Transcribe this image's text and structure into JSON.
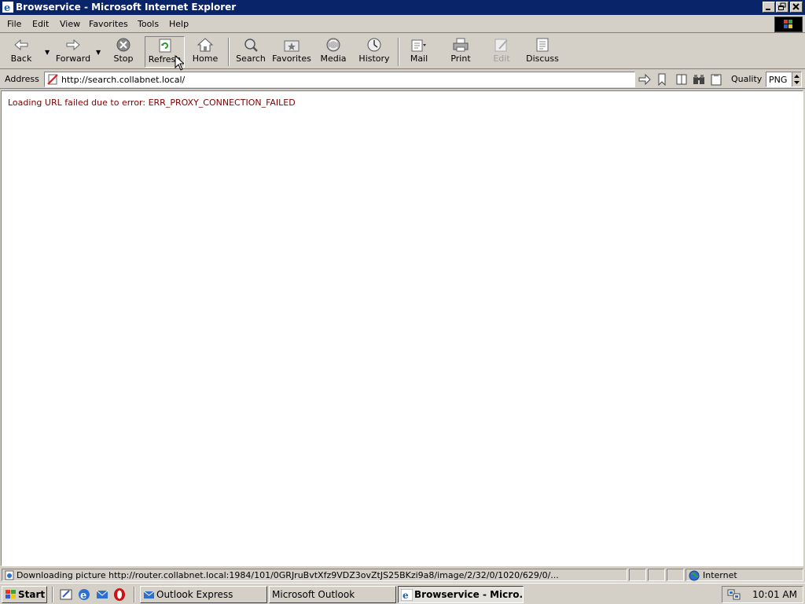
{
  "window": {
    "title": "Browservice - Microsoft Internet Explorer",
    "controls": [
      "minimize",
      "restore",
      "close"
    ]
  },
  "menubar": {
    "items": [
      {
        "label": "File"
      },
      {
        "label": "Edit"
      },
      {
        "label": "View"
      },
      {
        "label": "Favorites"
      },
      {
        "label": "Tools"
      },
      {
        "label": "Help"
      }
    ]
  },
  "toolbar": {
    "buttons": [
      {
        "label": "Back",
        "icon": "back-arrow-icon"
      },
      {
        "label": "Forward",
        "icon": "forward-arrow-icon"
      },
      {
        "label": "Stop",
        "icon": "stop-icon"
      },
      {
        "label": "Refresh",
        "icon": "refresh-icon",
        "state": "pressed"
      },
      {
        "label": "Home",
        "icon": "home-icon"
      },
      {
        "label": "Search",
        "icon": "search-icon"
      },
      {
        "label": "Favorites",
        "icon": "favorites-icon"
      },
      {
        "label": "Media",
        "icon": "media-icon"
      },
      {
        "label": "History",
        "icon": "history-icon"
      },
      {
        "label": "Mail",
        "icon": "mail-icon"
      },
      {
        "label": "Print",
        "icon": "print-icon"
      },
      {
        "label": "Edit",
        "icon": "edit-icon",
        "state": "disabled"
      },
      {
        "label": "Discuss",
        "icon": "discuss-icon"
      }
    ]
  },
  "addressbar": {
    "label": "Address",
    "url": "http://search.collabnet.local/",
    "quality_label": "Quality",
    "quality_value": "PNG"
  },
  "content": {
    "error_message": "Loading URL failed due to error: ERR_PROXY_CONNECTION_FAILED",
    "error_color": "#800000"
  },
  "statusbar": {
    "text": "Downloading picture http://router.collabnet.local:1984/101/0GRJruBvtXfz9VDZ3ovZtJS25BKzi9a8/image/2/32/0/1020/629/0/...",
    "zone": "Internet"
  },
  "taskbar": {
    "start_label": "Start",
    "tasks": [
      {
        "label": "Outlook Express",
        "active": false
      },
      {
        "label": "Microsoft Outlook",
        "active": false
      },
      {
        "label": "Browservice - Micro...",
        "active": true
      }
    ],
    "clock": "10:01 AM"
  },
  "colors": {
    "titlebar": "#0a246a",
    "chrome": "#d4d0c8",
    "content_bg": "#ffffff"
  }
}
